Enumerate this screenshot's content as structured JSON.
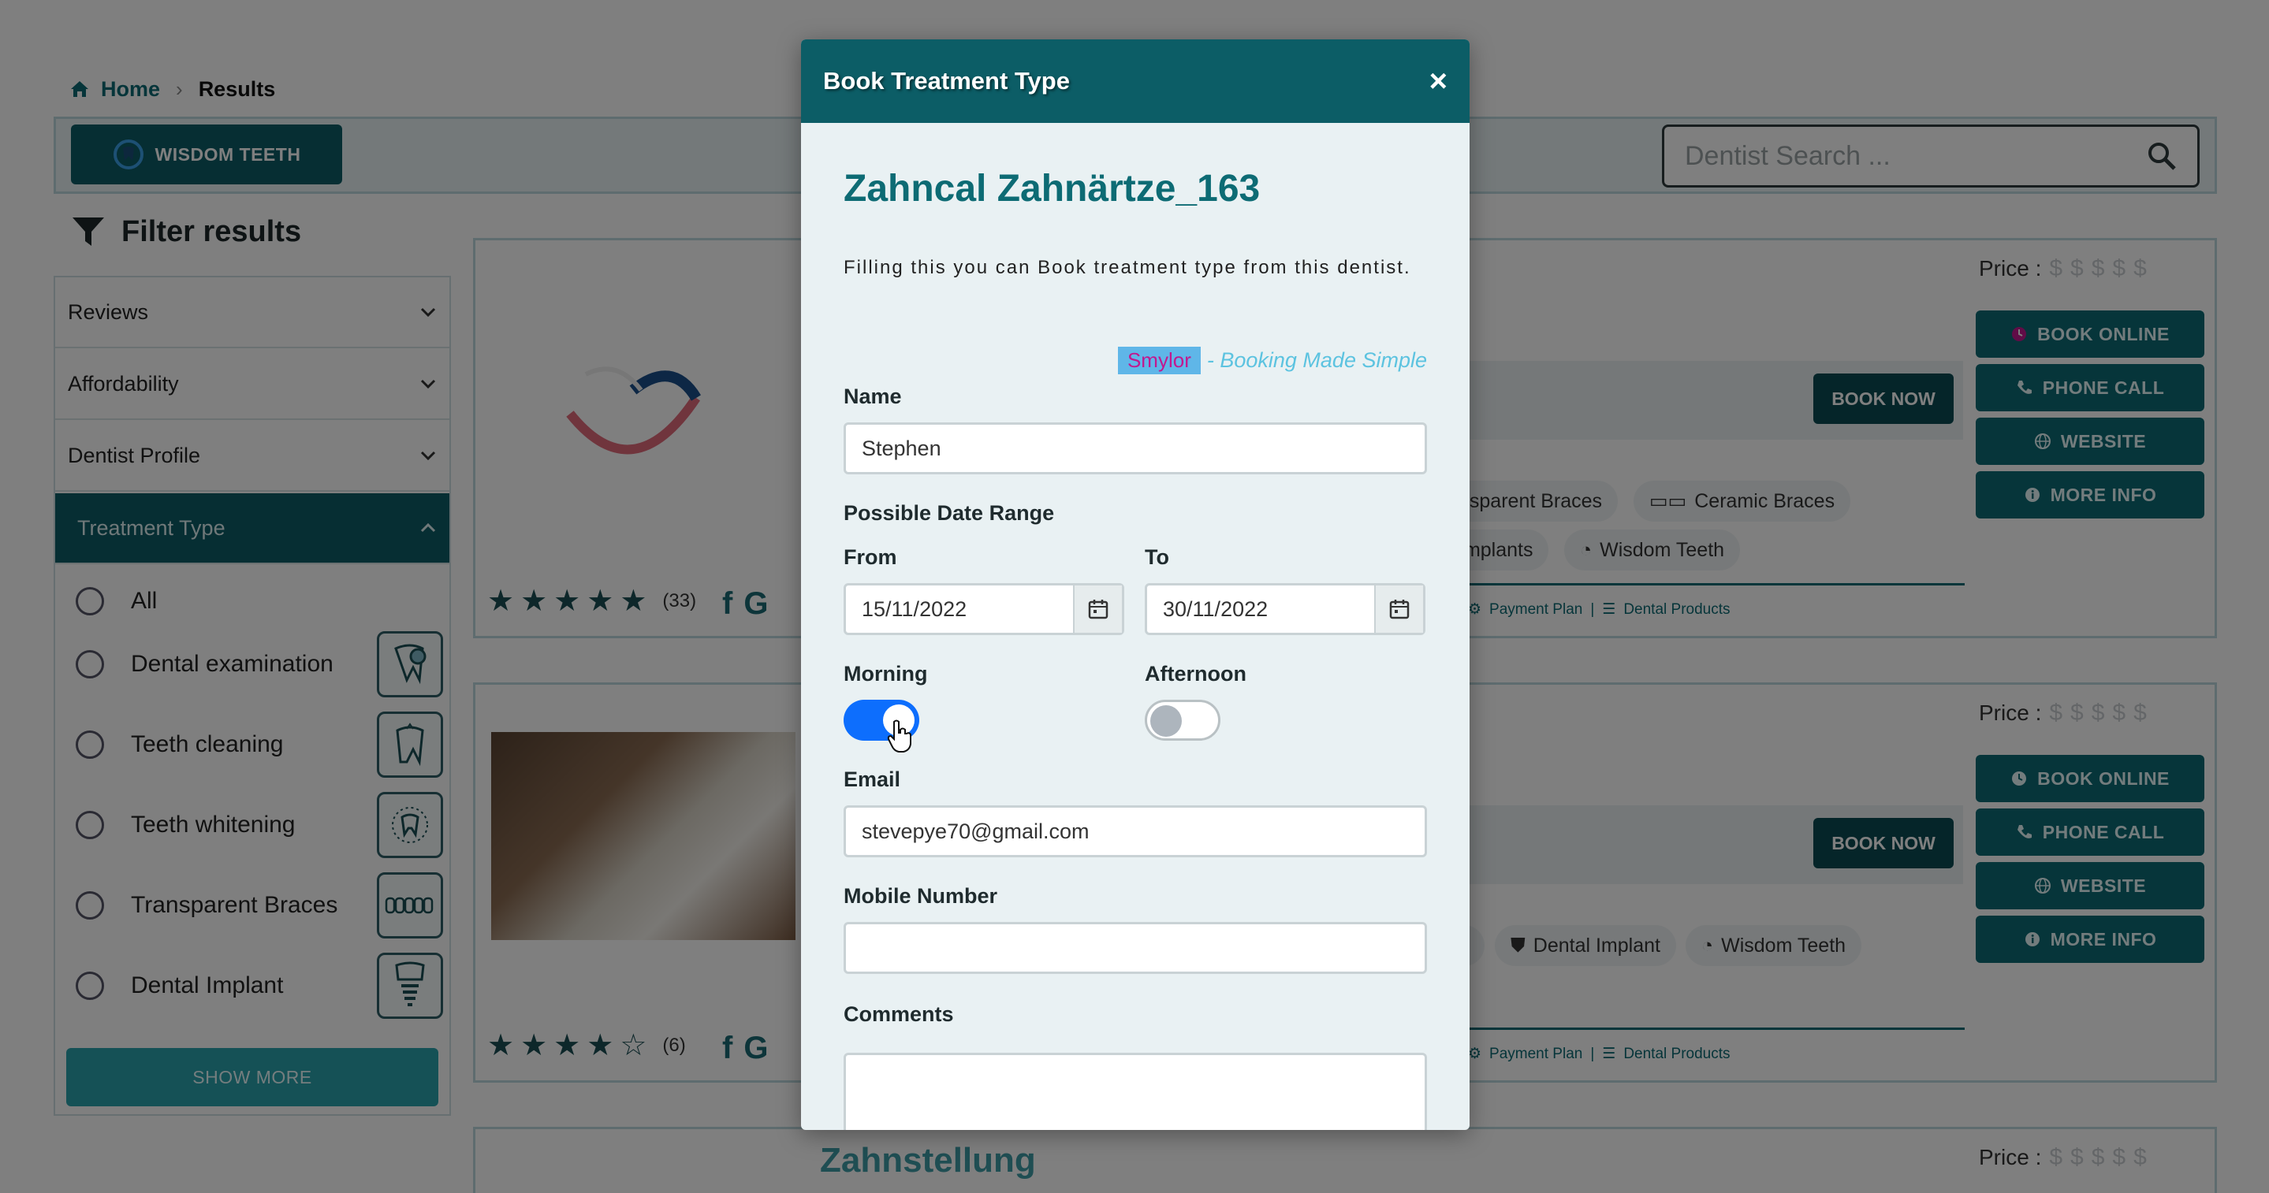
{
  "breadcrumb": {
    "home": "Home",
    "current": "Results"
  },
  "topbar": {
    "wisdom_button": "WISDOM TEETH",
    "search_placeholder": "Dentist Search ..."
  },
  "sidebar": {
    "title": "Filter results",
    "sections": [
      "Reviews",
      "Affordability",
      "Dentist Profile",
      "Treatment Type"
    ],
    "treatment_items": [
      "All",
      "Dental examination",
      "Teeth cleaning",
      "Teeth whitening",
      "Transparent Braces",
      "Dental Implant"
    ],
    "show_more": "SHOW MORE"
  },
  "cards": [
    {
      "price_label": "Price :",
      "actions": [
        "BOOK ONLINE",
        "PHONE CALL",
        "WEBSITE",
        "MORE INFO"
      ],
      "book_now": "BOOK NOW",
      "rating": 5,
      "rating_count": "(33)",
      "chips": [
        "nsparent Braces",
        "Ceramic Braces",
        "Implants",
        "Wisdom Teeth"
      ],
      "taglines": [
        "Payment Plan",
        "Dental Products"
      ]
    },
    {
      "price_label": "Price :",
      "actions": [
        "BOOK ONLINE",
        "PHONE CALL",
        "WEBSITE",
        "MORE INFO"
      ],
      "book_now": "BOOK NOW",
      "rating": 4,
      "rating_count": "(6)",
      "chips": [
        "s",
        "Dental Implant",
        "Wisdom Teeth"
      ],
      "taglines": [
        "Payment Plan",
        "Dental Products"
      ]
    },
    {
      "price_label": "Price :",
      "title": "Zahnstellung"
    }
  ],
  "modal": {
    "title": "Book Treatment Type",
    "close": "×",
    "clinic_name": "Zahncal Zahnärtze_163",
    "description": "Filling this you can Book treatment type from this dentist.",
    "brand_logo": "Smylor",
    "brand_tagline": "- Booking Made Simple",
    "name_label": "Name",
    "name_value": "Stephen",
    "date_range_label": "Possible Date Range",
    "from_label": "From",
    "from_value": "15/11/2022",
    "to_label": "To",
    "to_value": "30/11/2022",
    "morning_label": "Morning",
    "afternoon_label": "Afternoon",
    "morning_on": true,
    "afternoon_on": false,
    "email_label": "Email",
    "email_value": "stevepye70@gmail.com",
    "mobile_label": "Mobile Number",
    "mobile_value": "",
    "comments_label": "Comments"
  },
  "colors": {
    "teal_dark": "#0c5d66",
    "teal": "#0d6b74",
    "toggle_on": "#0d6efd"
  }
}
